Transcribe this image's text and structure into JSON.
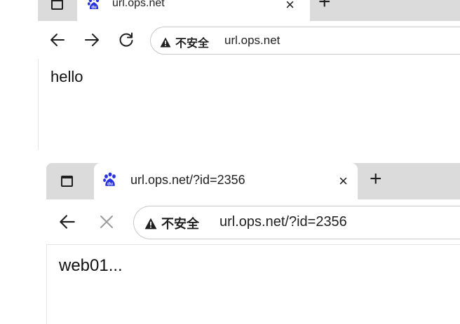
{
  "windows": [
    {
      "tab": {
        "title": "url.ops.net",
        "close_glyph": "×"
      },
      "new_tab_glyph": "+",
      "security_label": "不安全",
      "address_url": "url.ops.net",
      "page_text": "hello",
      "icons": {
        "favicon": "baidu-paw-icon",
        "back": "back-arrow-icon",
        "forward": "forward-arrow-icon",
        "reload": "reload-icon",
        "warning": "warning-triangle-icon"
      }
    },
    {
      "tab": {
        "title": "url.ops.net/?id=2356",
        "close_glyph": "×"
      },
      "new_tab_glyph": "+",
      "security_label": "不安全",
      "address_url": "url.ops.net/?id=2356",
      "page_text": "web01...",
      "icons": {
        "favicon": "baidu-paw-icon",
        "back": "back-arrow-icon",
        "stop": "stop-loading-icon",
        "warning": "warning-triangle-icon"
      }
    }
  ],
  "colors": {
    "tabstrip": "#dbdbdb",
    "favicon": "#2932e1",
    "text": "#1f1f1f"
  }
}
